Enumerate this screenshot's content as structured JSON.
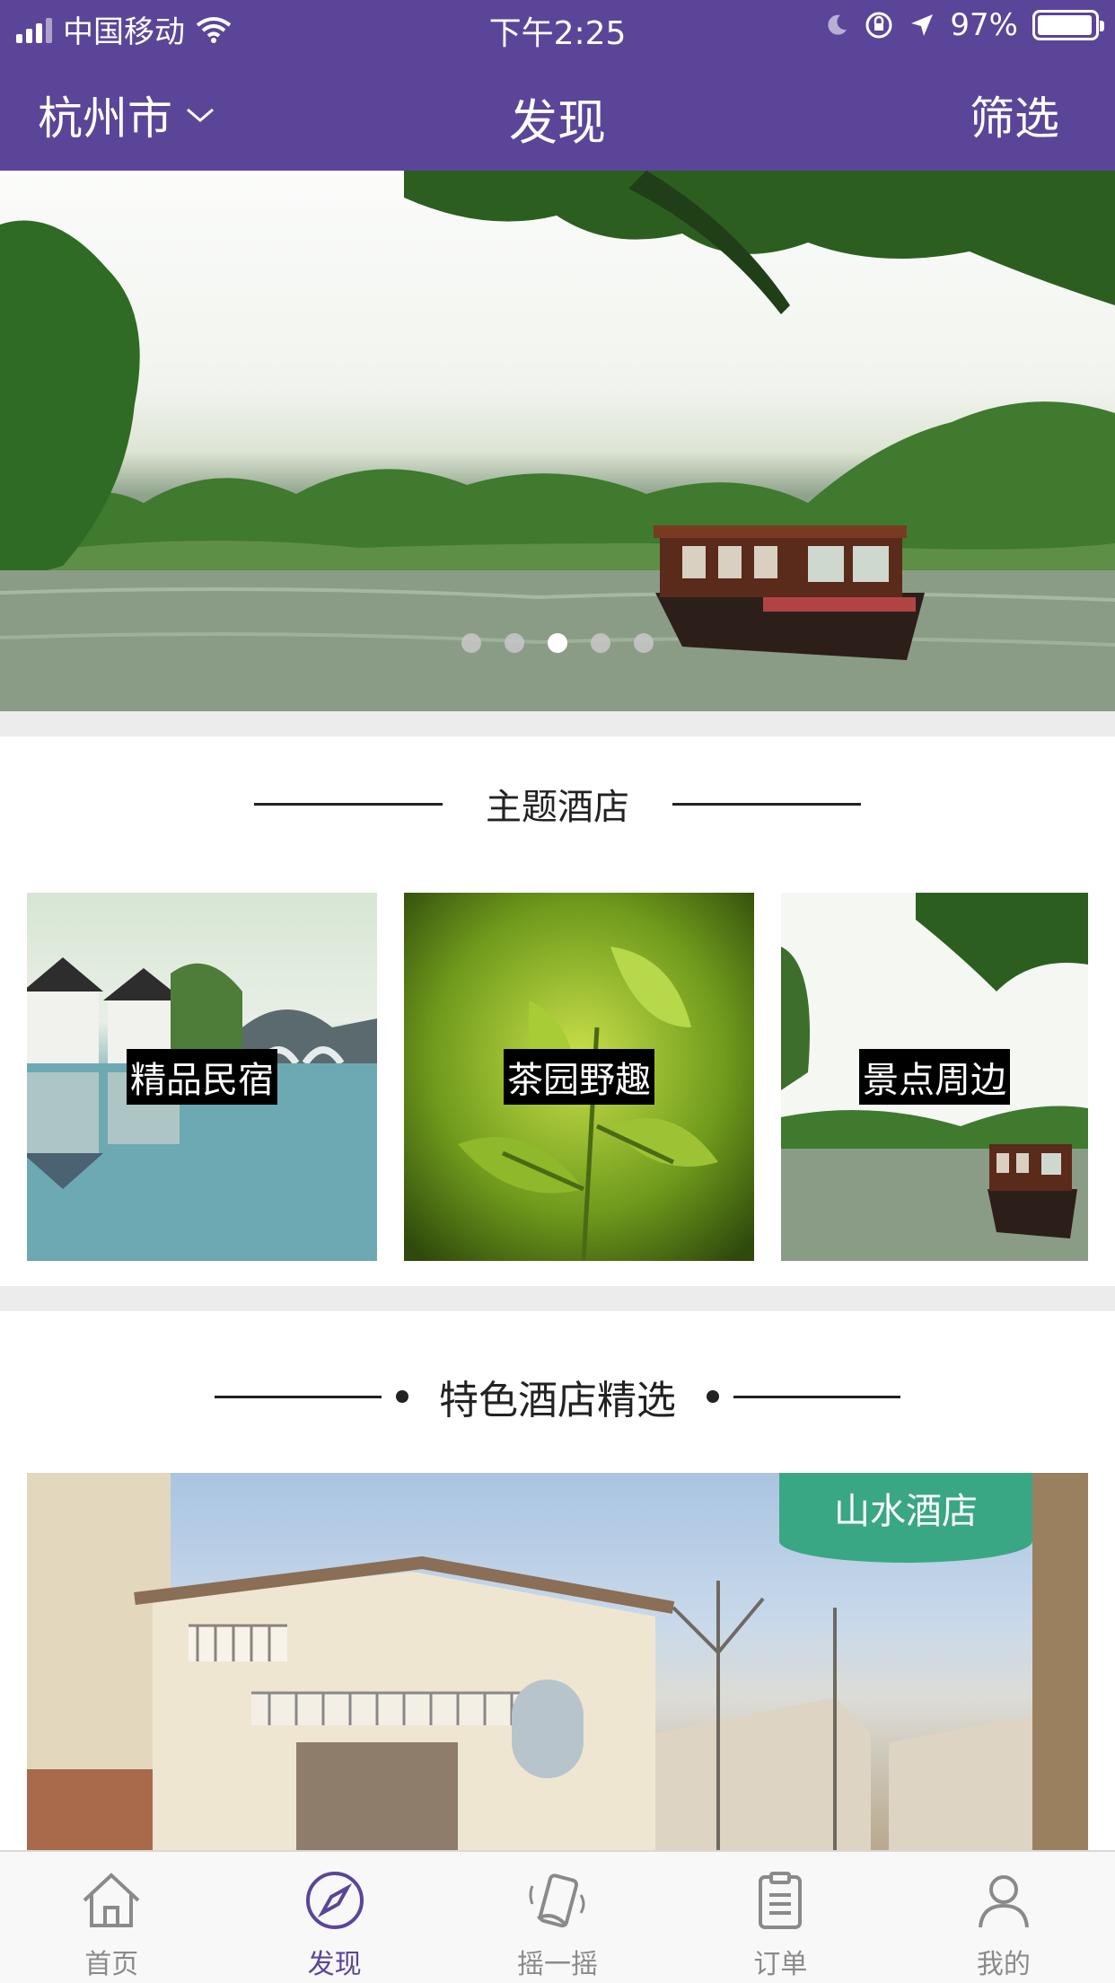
{
  "status_bar": {
    "carrier": "中国移动",
    "time": "下午2:25",
    "battery_text": "97%",
    "battery_level": 0.97
  },
  "navbar": {
    "city": "杭州市",
    "title": "发现",
    "filter": "筛选"
  },
  "banner": {
    "slide_count": 5,
    "active_index": 2
  },
  "theme_section": {
    "title": "主题酒店",
    "items": [
      {
        "label": "精品民宿"
      },
      {
        "label": "茶园野趣"
      },
      {
        "label": "景点周边"
      }
    ]
  },
  "featured_section": {
    "title": "特色酒店精选",
    "card": {
      "badge": "山水酒店"
    }
  },
  "tabbar": {
    "items": [
      {
        "label": "首页",
        "icon": "home-icon"
      },
      {
        "label": "发现",
        "icon": "compass-icon",
        "active": true
      },
      {
        "label": "摇一摇",
        "icon": "shake-phone-icon"
      },
      {
        "label": "订单",
        "icon": "clipboard-icon"
      },
      {
        "label": "我的",
        "icon": "user-icon"
      }
    ]
  },
  "colors": {
    "brand_purple": "#5b4598",
    "badge_green": "#3aa784",
    "tab_inactive": "#8a8a8a"
  }
}
